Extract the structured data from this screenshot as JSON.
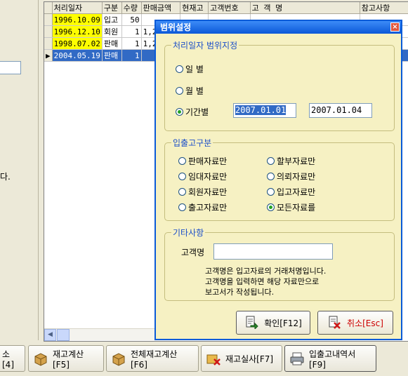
{
  "left": {
    "text": "다."
  },
  "grid": {
    "columns": [
      "처리일자",
      "구분",
      "수량",
      "판매금액",
      "현재고",
      "고객번호",
      "고 객 명",
      "참고사항"
    ],
    "rows": [
      {
        "date": "1996.10.09",
        "type": "입고",
        "qty": "50",
        "amount": "",
        "stock": "",
        "cust_no": "",
        "cust_name": "",
        "note": ""
      },
      {
        "date": "1996.12.10",
        "type": "회원",
        "qty": "1",
        "amount": "1,2",
        "stock": "",
        "cust_no": "",
        "cust_name": "",
        "note": ""
      },
      {
        "date": "1998.07.02",
        "type": "판매",
        "qty": "1",
        "amount": "1,2",
        "stock": "",
        "cust_no": "",
        "cust_name": "",
        "note": ""
      },
      {
        "date": "2004.05.19",
        "type": "판매",
        "qty": "1",
        "amount": "",
        "stock": "",
        "cust_no": "",
        "cust_name": "",
        "note": ""
      }
    ]
  },
  "toolbar": {
    "btn1": "소[4]",
    "btn2": "재고계산[F5]",
    "btn3": "전체재고계산[F6]",
    "btn4": "재고실사[F7]",
    "btn5": "입출고내역서[F9]"
  },
  "dialog": {
    "title": "범위설정",
    "close": "×",
    "range_group": {
      "title": "처리일자 범위지정",
      "daily": "일   별",
      "monthly": "월   별",
      "period": "기간별",
      "selected": "period",
      "from": "2007.01.01",
      "to": "2007.01.04"
    },
    "io_group": {
      "title": "입출고구분",
      "options": [
        "판매자료만",
        "할부자료만",
        "임대자료만",
        "의뢰자료만",
        "회원자료만",
        "입고자료만",
        "출고자료만",
        "모든자료를"
      ],
      "selected": "모든자료를"
    },
    "etc_group": {
      "title": "기타사항",
      "customer_label": "고객명",
      "customer_value": "",
      "note1": "고객명은 입고자료의 거래처명입니다.",
      "note2": "고객명을 입력하면 해당 자료만으로",
      "note3": "보고서가 작성됩니다."
    },
    "ok": "확인[F12]",
    "cancel": "취소[Esc]"
  },
  "colors": {
    "titlebar": "#0b58d8",
    "dialog_bg": "#f6f1c3",
    "group_title": "#1c4fc8",
    "selection": "#316ac5",
    "date_highlight": "#ffff00",
    "cancel_text": "#cc0000"
  }
}
